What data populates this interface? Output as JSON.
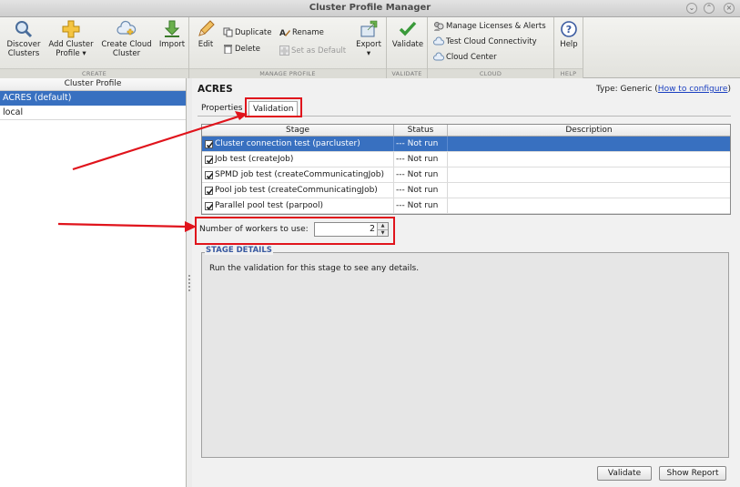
{
  "window": {
    "title": "Cluster Profile Manager"
  },
  "ribbon": {
    "create": {
      "label": "CREATE",
      "discover": {
        "line1": "Discover",
        "line2": "Clusters"
      },
      "add_cluster_profile": {
        "line1": "Add Cluster",
        "line2": "Profile ▾"
      },
      "create_cloud_cluster": {
        "line1": "Create Cloud",
        "line2": "Cluster"
      },
      "import": "Import"
    },
    "manage": {
      "label": "MANAGE PROFILE",
      "edit": "Edit",
      "duplicate": "Duplicate",
      "rename": "Rename",
      "delete": "Delete",
      "set_default": "Set as Default",
      "export": "Export"
    },
    "validate": {
      "label": "VALIDATE",
      "validate": "Validate"
    },
    "cloud": {
      "label": "CLOUD",
      "manage_licenses": "Manage Licenses & Alerts",
      "test_connectivity": "Test Cloud Connectivity",
      "cloud_center": "Cloud Center"
    },
    "help": {
      "label": "HELP",
      "help": "Help"
    }
  },
  "left_panel": {
    "header": "Cluster Profile",
    "items": [
      {
        "label": "ACRES (default)",
        "selected": true
      },
      {
        "label": "local",
        "selected": false
      }
    ]
  },
  "main": {
    "title": "ACRES",
    "type_prefix": "Type: Generic (",
    "type_link": "How to configure",
    "type_suffix": ")",
    "tabs": [
      {
        "label": "Properties"
      },
      {
        "label": "Validation"
      }
    ],
    "table": {
      "headers": [
        "Stage",
        "Status",
        "Description"
      ],
      "rows": [
        {
          "stage": "Cluster connection test (parcluster)",
          "status": "--- Not run",
          "description": "",
          "checked": true,
          "selected": true
        },
        {
          "stage": "Job test (createJob)",
          "status": "--- Not run",
          "description": "",
          "checked": true,
          "selected": false
        },
        {
          "stage": "SPMD job test (createCommunicatingJob)",
          "status": "--- Not run",
          "description": "",
          "checked": true,
          "selected": false
        },
        {
          "stage": "Pool job test (createCommunicatingJob)",
          "status": "--- Not run",
          "description": "",
          "checked": true,
          "selected": false
        },
        {
          "stage": "Parallel pool test (parpool)",
          "status": "--- Not run",
          "description": "",
          "checked": true,
          "selected": false
        }
      ]
    },
    "workers": {
      "label": "Number of workers to use:",
      "value": "2"
    },
    "details": {
      "title": "STAGE DETAILS",
      "text": "Run the validation for this stage to see any details."
    },
    "buttons": {
      "validate": "Validate",
      "show_report": "Show Report"
    }
  },
  "colors": {
    "selection": "#3870c0",
    "annotation": "#e0141c",
    "link": "#1a3fc0"
  }
}
